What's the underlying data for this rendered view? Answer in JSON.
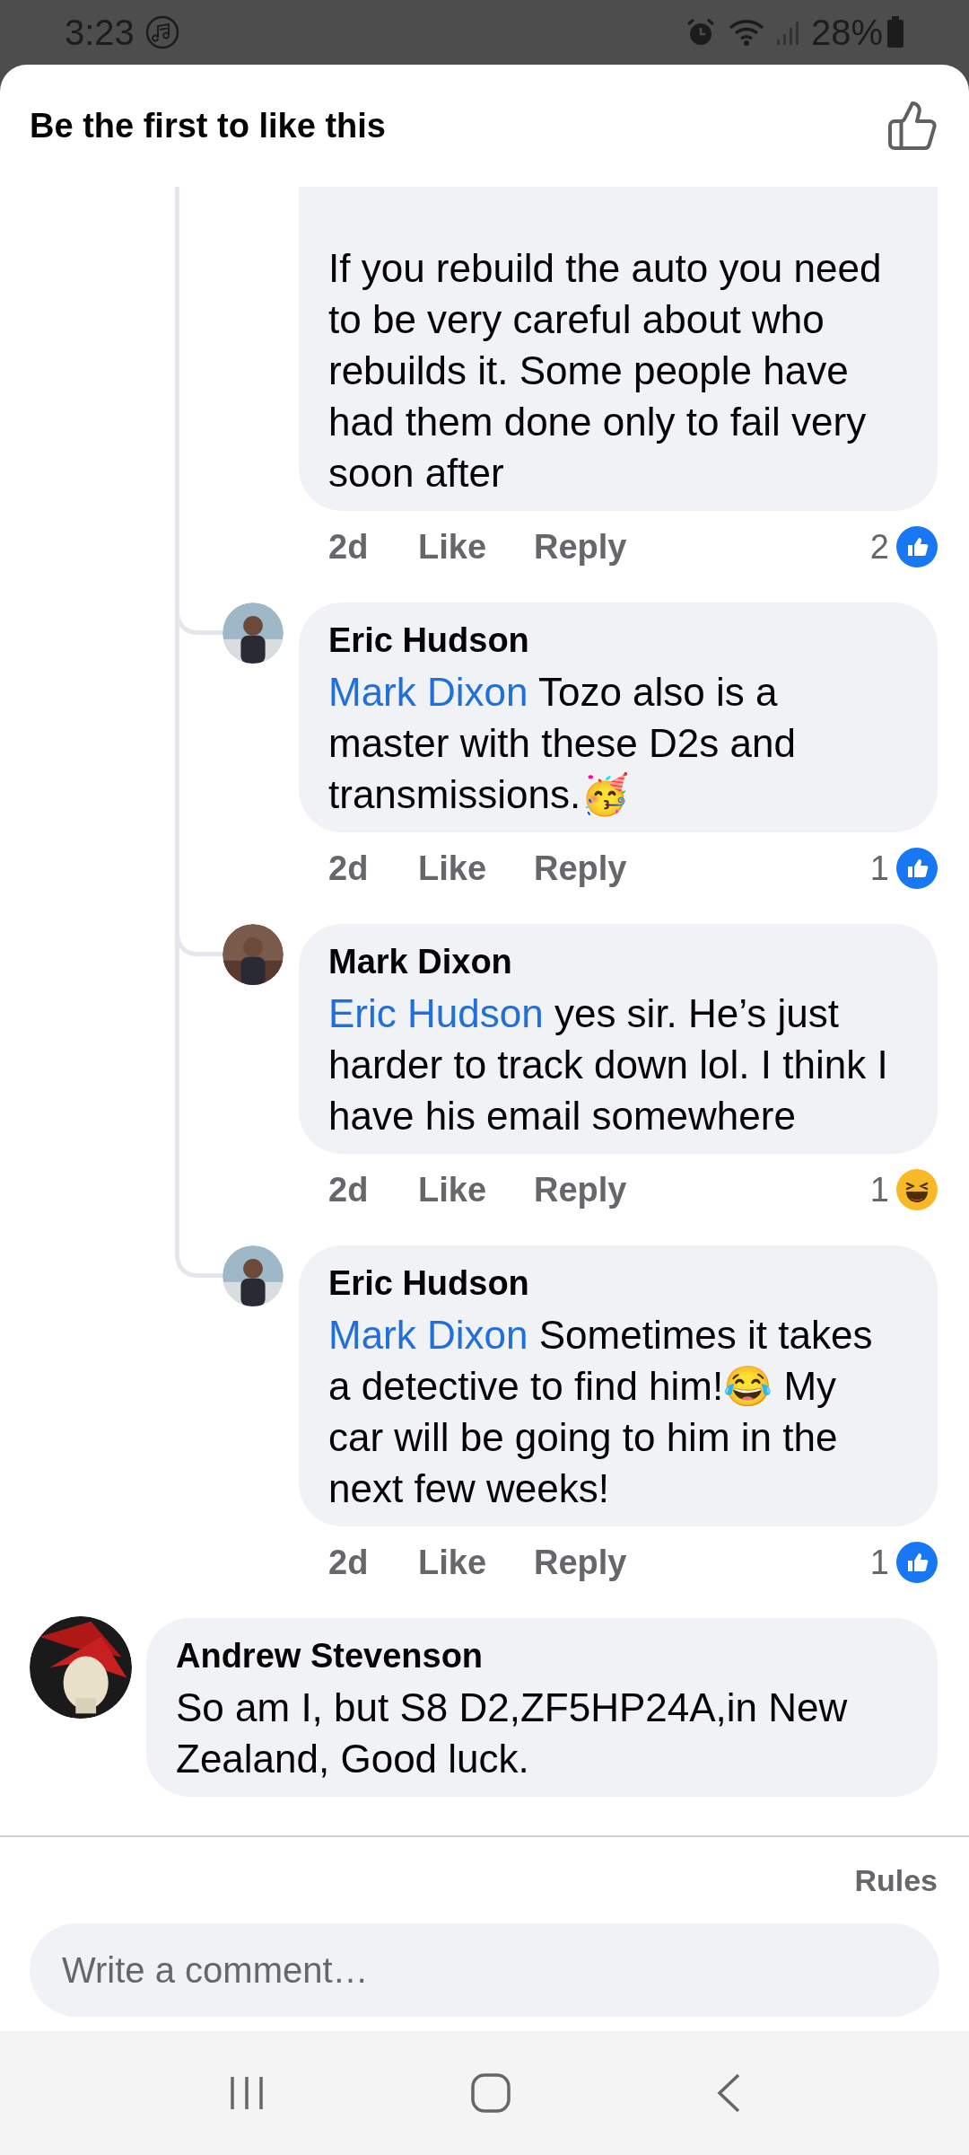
{
  "status_bar": {
    "time": "3:23",
    "battery": "28%"
  },
  "header": {
    "title": "Be the first to like this"
  },
  "thread": [
    {
      "text": "If you rebuild the auto you need to be very careful about who rebuilds it. Some people have had them done only to fail very soon after",
      "time": "2d",
      "like": "Like",
      "reply": "Reply",
      "reaction_count": "2",
      "kind": "like"
    },
    {
      "author": "Eric Hudson",
      "mention": "Mark Dixon",
      "text": "Tozo also is a master with these D2s and transmissions.🥳",
      "time": "2d",
      "like": "Like",
      "reply": "Reply",
      "reaction_count": "1",
      "kind": "like"
    },
    {
      "author": "Mark Dixon",
      "mention": "Eric Hudson",
      "text": "yes sir. He’s just harder to track down lol. I think I have his email somewhere",
      "time": "2d",
      "like": "Like",
      "reply": "Reply",
      "reaction_count": "1",
      "kind": "haha"
    },
    {
      "author": "Eric Hudson",
      "mention": "Mark Dixon",
      "text": "Sometimes it takes a detective to find him!😂 My car will be going to him in the next few weeks!",
      "time": "2d",
      "like": "Like",
      "reply": "Reply",
      "reaction_count": "1",
      "kind": "like"
    }
  ],
  "comments": [
    {
      "author": "Andrew Stevenson",
      "text": "So am I, but S8 D2,ZF5HP24A,in New Zealand, Good luck."
    }
  ],
  "footer": {
    "rules": "Rules",
    "placeholder": "Write a comment…"
  }
}
